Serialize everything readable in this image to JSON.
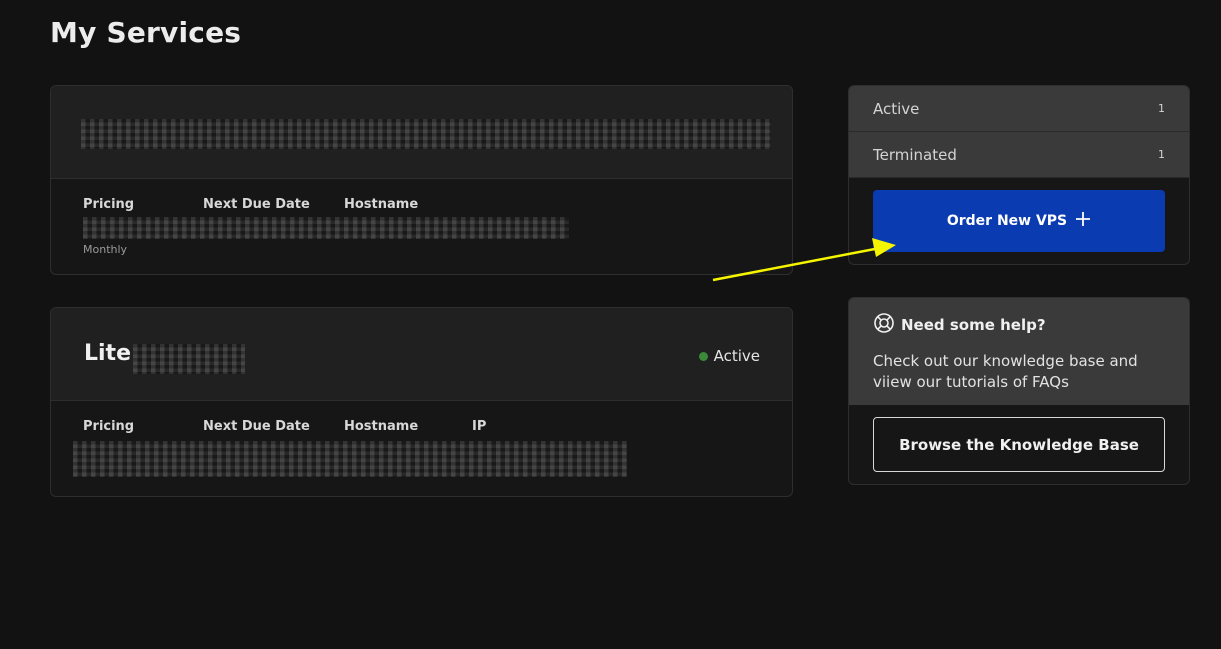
{
  "page": {
    "title": "My Services"
  },
  "services": [
    {
      "name": "",
      "status": "",
      "columns": [
        "Pricing",
        "Next Due Date",
        "Hostname"
      ],
      "billing_cycle": "Monthly"
    },
    {
      "name": "Lite",
      "status": "Active",
      "status_color": "#3a8a3a",
      "columns": [
        "Pricing",
        "Next Due Date",
        "Hostname",
        "IP"
      ]
    }
  ],
  "sidebar": {
    "filters": [
      {
        "label": "Active",
        "count": "1"
      },
      {
        "label": "Terminated",
        "count": "1"
      }
    ],
    "order_button": {
      "label": "Order New VPS",
      "icon": "plus-icon",
      "color": "#0a3bb0"
    },
    "help": {
      "icon": "lifebuoy-icon",
      "title": "Need some help?",
      "text": "Check out our knowledge base and viiew our tutorials of FAQs",
      "button_label": "Browse the Knowledge Base"
    }
  },
  "annotation": {
    "arrow_color": "#f5f500"
  }
}
